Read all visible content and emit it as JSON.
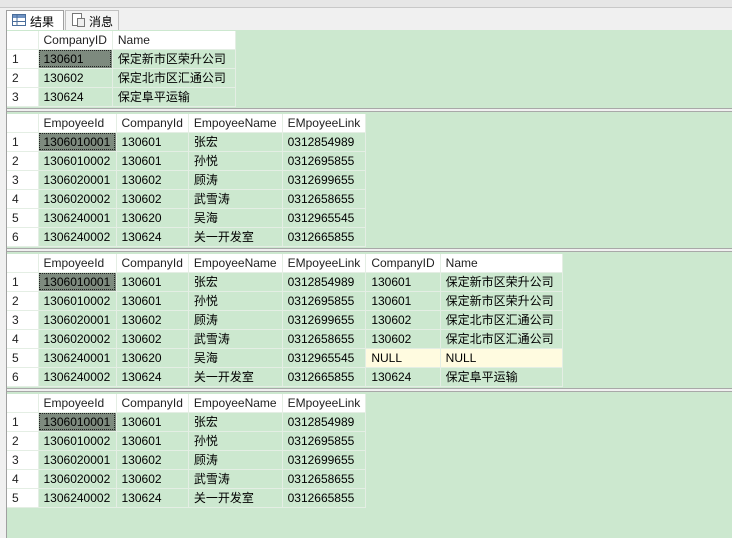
{
  "tabs": [
    {
      "label": "结果",
      "icon": "grid-icon"
    },
    {
      "label": "消息",
      "icon": "message-icon"
    }
  ],
  "grids": [
    {
      "columns": [
        "CompanyID",
        "Name"
      ],
      "widths": [
        74,
        123
      ],
      "rows": [
        [
          "130601",
          "保定新市区荣升公司"
        ],
        [
          "130602",
          "保定北市区汇通公司"
        ],
        [
          "130624",
          "保定阜平运输"
        ]
      ]
    },
    {
      "columns": [
        "EmpoyeeId",
        "CompanyId",
        "EmpoyeeName",
        "EMpoyeeLink"
      ],
      "widths": [
        78,
        68,
        90,
        80
      ],
      "rows": [
        [
          "1306010001",
          "130601",
          "张宏",
          "0312854989"
        ],
        [
          "1306010002",
          "130601",
          "孙悦",
          "0312695855"
        ],
        [
          "1306020001",
          "130602",
          "顾涛",
          "0312699655"
        ],
        [
          "1306020002",
          "130602",
          "武雪涛",
          "0312658655"
        ],
        [
          "1306240001",
          "130620",
          "吴海",
          "0312965545"
        ],
        [
          "1306240002",
          "130624",
          "关一开发室",
          "0312665855"
        ]
      ]
    },
    {
      "columns": [
        "EmpoyeeId",
        "CompanyId",
        "EmpoyeeName",
        "EMpoyeeLink",
        "CompanyID",
        "Name"
      ],
      "widths": [
        78,
        68,
        90,
        80,
        72,
        122
      ],
      "rows": [
        [
          "1306010001",
          "130601",
          "张宏",
          "0312854989",
          "130601",
          "保定新市区荣升公司"
        ],
        [
          "1306010002",
          "130601",
          "孙悦",
          "0312695855",
          "130601",
          "保定新市区荣升公司"
        ],
        [
          "1306020001",
          "130602",
          "顾涛",
          "0312699655",
          "130602",
          "保定北市区汇通公司"
        ],
        [
          "1306020002",
          "130602",
          "武雪涛",
          "0312658655",
          "130602",
          "保定北市区汇通公司"
        ],
        [
          "1306240001",
          "130620",
          "吴海",
          "0312965545",
          "NULL",
          "NULL"
        ],
        [
          "1306240002",
          "130624",
          "关一开发室",
          "0312665855",
          "130624",
          "保定阜平运输"
        ]
      ]
    },
    {
      "columns": [
        "EmpoyeeId",
        "CompanyId",
        "EmpoyeeName",
        "EMpoyeeLink"
      ],
      "widths": [
        78,
        68,
        90,
        80
      ],
      "rows": [
        [
          "1306010001",
          "130601",
          "张宏",
          "0312854989"
        ],
        [
          "1306010002",
          "130601",
          "孙悦",
          "0312695855"
        ],
        [
          "1306020001",
          "130602",
          "顾涛",
          "0312699655"
        ],
        [
          "1306020002",
          "130602",
          "武雪涛",
          "0312658655"
        ],
        [
          "1306240002",
          "130624",
          "关一开发室",
          "0312665855"
        ]
      ]
    }
  ]
}
